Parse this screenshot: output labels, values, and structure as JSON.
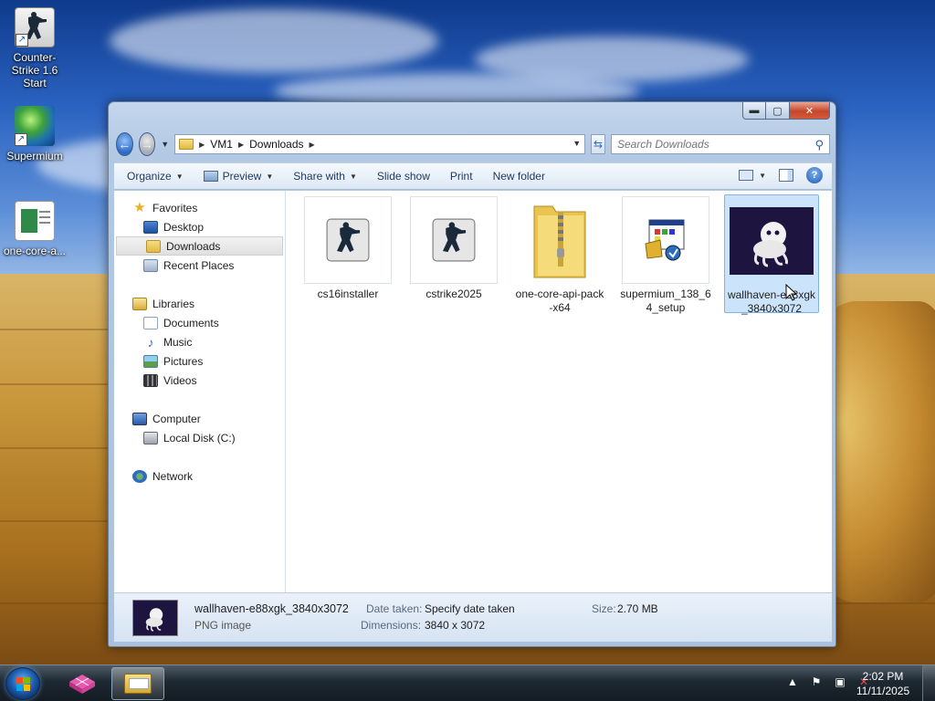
{
  "desktop": {
    "icons": [
      {
        "label": "Counter-Strike 1.6 Start",
        "icon": "counter-strike-icon"
      },
      {
        "label": "Supermium",
        "icon": "supermium-globe-icon"
      },
      {
        "label": "one-core-a...",
        "icon": "document-icon"
      }
    ]
  },
  "window": {
    "caption_buttons": {
      "minimize": "▬",
      "maximize": "▢",
      "close": "✕"
    },
    "address": {
      "crumbs": [
        "VM1",
        "Downloads"
      ],
      "search_placeholder": "Search Downloads"
    },
    "toolbar": {
      "organize": "Organize",
      "preview": "Preview",
      "share_with": "Share with",
      "slide_show": "Slide show",
      "print": "Print",
      "new_folder": "New folder"
    },
    "nav": {
      "favorites": "Favorites",
      "desktop": "Desktop",
      "downloads": "Downloads",
      "recent_places": "Recent Places",
      "libraries": "Libraries",
      "documents": "Documents",
      "music": "Music",
      "pictures": "Pictures",
      "videos": "Videos",
      "computer": "Computer",
      "local_disk": "Local Disk (C:)",
      "network": "Network"
    },
    "files": [
      {
        "name": "cs16installer",
        "icon": "counter-strike-icon"
      },
      {
        "name": "cstrike2025",
        "icon": "counter-strike-icon"
      },
      {
        "name": "one-core-api-pack-x64",
        "icon": "zip-folder-icon"
      },
      {
        "name": "supermium_138_64_setup",
        "icon": "installer-icon"
      },
      {
        "name": "wallhaven-e88xgk_3840x3072",
        "icon": "image-thumbnail",
        "selected": true
      }
    ],
    "details": {
      "name": "wallhaven-e88xgk_3840x3072",
      "type": "PNG image",
      "date_taken_label": "Date taken:",
      "date_taken_value": "Specify date taken",
      "dimensions_label": "Dimensions:",
      "dimensions_value": "3840 x 3072",
      "size_label": "Size:",
      "size_value": "2.70 MB"
    }
  },
  "taskbar": {
    "clock_time": "2:02 PM",
    "clock_date": "11/11/2025",
    "tray_icons": [
      "show-hidden-icons-icon",
      "action-center-flag-icon",
      "network-icon",
      "volume-muted-icon"
    ]
  },
  "colors": {
    "selection": "#cce4fb",
    "selection_border": "#7eb4ea",
    "window_frame": "#b2c8e3",
    "taskbar": "#1d2831"
  }
}
